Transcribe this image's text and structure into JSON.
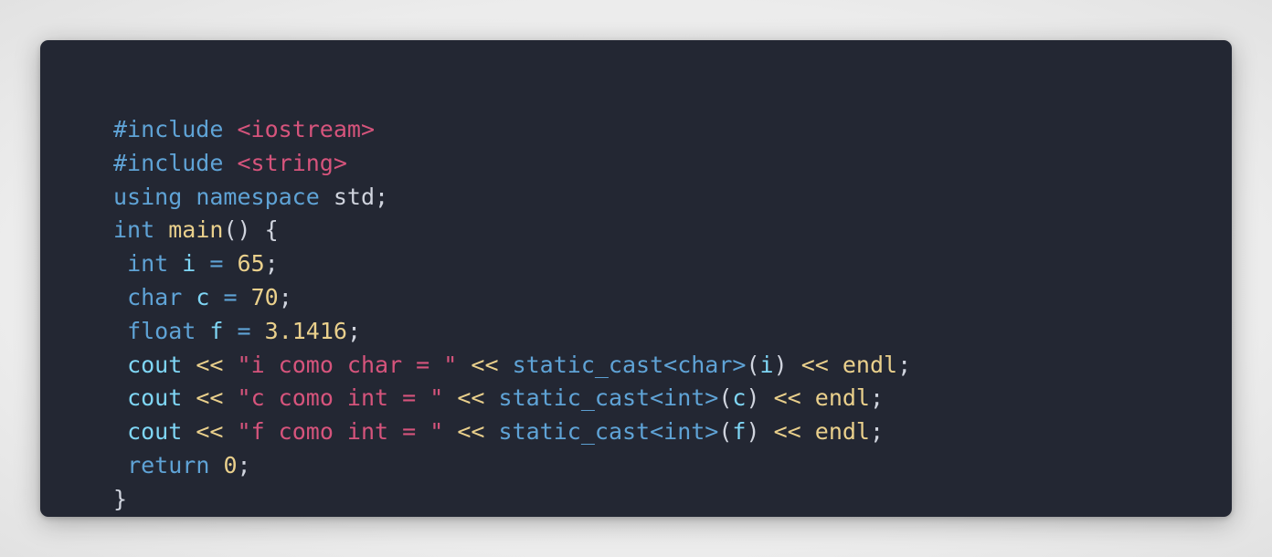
{
  "colors": {
    "background": "#ececec",
    "card": "#232733",
    "keyword": "#5fa3d6",
    "string": "#d6547c",
    "number": "#ead08c",
    "ident": "#7fd6f5",
    "function": "#ead08c",
    "plain": "#d0d4de"
  },
  "code": {
    "lines": [
      [
        {
          "t": "#include",
          "k": "keyword"
        },
        {
          "t": " ",
          "k": "plain"
        },
        {
          "t": "<iostream>",
          "k": "string"
        }
      ],
      [
        {
          "t": "#include",
          "k": "keyword"
        },
        {
          "t": " ",
          "k": "plain"
        },
        {
          "t": "<string>",
          "k": "string"
        }
      ],
      [
        {
          "t": "using",
          "k": "keyword"
        },
        {
          "t": " ",
          "k": "plain"
        },
        {
          "t": "namespace",
          "k": "keyword"
        },
        {
          "t": " std;",
          "k": "plain"
        }
      ],
      [
        {
          "t": "int",
          "k": "keyword"
        },
        {
          "t": " ",
          "k": "plain"
        },
        {
          "t": "main",
          "k": "function"
        },
        {
          "t": "() {",
          "k": "plain"
        }
      ],
      [
        {
          "t": " ",
          "k": "plain"
        },
        {
          "t": "int",
          "k": "keyword"
        },
        {
          "t": " ",
          "k": "plain"
        },
        {
          "t": "i",
          "k": "ident"
        },
        {
          "t": " ",
          "k": "plain"
        },
        {
          "t": "=",
          "k": "keyword"
        },
        {
          "t": " ",
          "k": "plain"
        },
        {
          "t": "65",
          "k": "number"
        },
        {
          "t": ";",
          "k": "plain"
        }
      ],
      [
        {
          "t": " ",
          "k": "plain"
        },
        {
          "t": "char",
          "k": "keyword"
        },
        {
          "t": " ",
          "k": "plain"
        },
        {
          "t": "c",
          "k": "ident"
        },
        {
          "t": " ",
          "k": "plain"
        },
        {
          "t": "=",
          "k": "keyword"
        },
        {
          "t": " ",
          "k": "plain"
        },
        {
          "t": "70",
          "k": "number"
        },
        {
          "t": ";",
          "k": "plain"
        }
      ],
      [
        {
          "t": " ",
          "k": "plain"
        },
        {
          "t": "float",
          "k": "keyword"
        },
        {
          "t": " ",
          "k": "plain"
        },
        {
          "t": "f",
          "k": "ident"
        },
        {
          "t": " ",
          "k": "plain"
        },
        {
          "t": "=",
          "k": "keyword"
        },
        {
          "t": " ",
          "k": "plain"
        },
        {
          "t": "3.1416",
          "k": "number"
        },
        {
          "t": ";",
          "k": "plain"
        }
      ],
      [
        {
          "t": " ",
          "k": "plain"
        },
        {
          "t": "cout",
          "k": "ident"
        },
        {
          "t": " ",
          "k": "plain"
        },
        {
          "t": "<<",
          "k": "number"
        },
        {
          "t": " ",
          "k": "plain"
        },
        {
          "t": "\"i como char = \"",
          "k": "string"
        },
        {
          "t": " ",
          "k": "plain"
        },
        {
          "t": "<<",
          "k": "number"
        },
        {
          "t": " ",
          "k": "plain"
        },
        {
          "t": "static_cast<char>",
          "k": "keyword"
        },
        {
          "t": "(",
          "k": "plain"
        },
        {
          "t": "i",
          "k": "ident"
        },
        {
          "t": ")",
          "k": "plain"
        },
        {
          "t": " ",
          "k": "plain"
        },
        {
          "t": "<<",
          "k": "number"
        },
        {
          "t": " ",
          "k": "plain"
        },
        {
          "t": "endl",
          "k": "number"
        },
        {
          "t": ";",
          "k": "plain"
        }
      ],
      [
        {
          "t": " ",
          "k": "plain"
        },
        {
          "t": "cout",
          "k": "ident"
        },
        {
          "t": " ",
          "k": "plain"
        },
        {
          "t": "<<",
          "k": "number"
        },
        {
          "t": " ",
          "k": "plain"
        },
        {
          "t": "\"c como int = \"",
          "k": "string"
        },
        {
          "t": " ",
          "k": "plain"
        },
        {
          "t": "<<",
          "k": "number"
        },
        {
          "t": " ",
          "k": "plain"
        },
        {
          "t": "static_cast<int>",
          "k": "keyword"
        },
        {
          "t": "(",
          "k": "plain"
        },
        {
          "t": "c",
          "k": "ident"
        },
        {
          "t": ")",
          "k": "plain"
        },
        {
          "t": " ",
          "k": "plain"
        },
        {
          "t": "<<",
          "k": "number"
        },
        {
          "t": " ",
          "k": "plain"
        },
        {
          "t": "endl",
          "k": "number"
        },
        {
          "t": ";",
          "k": "plain"
        }
      ],
      [
        {
          "t": " ",
          "k": "plain"
        },
        {
          "t": "cout",
          "k": "ident"
        },
        {
          "t": " ",
          "k": "plain"
        },
        {
          "t": "<<",
          "k": "number"
        },
        {
          "t": " ",
          "k": "plain"
        },
        {
          "t": "\"f como int = \"",
          "k": "string"
        },
        {
          "t": " ",
          "k": "plain"
        },
        {
          "t": "<<",
          "k": "number"
        },
        {
          "t": " ",
          "k": "plain"
        },
        {
          "t": "static_cast<int>",
          "k": "keyword"
        },
        {
          "t": "(",
          "k": "plain"
        },
        {
          "t": "f",
          "k": "ident"
        },
        {
          "t": ")",
          "k": "plain"
        },
        {
          "t": " ",
          "k": "plain"
        },
        {
          "t": "<<",
          "k": "number"
        },
        {
          "t": " ",
          "k": "plain"
        },
        {
          "t": "endl",
          "k": "number"
        },
        {
          "t": ";",
          "k": "plain"
        }
      ],
      [
        {
          "t": " ",
          "k": "plain"
        },
        {
          "t": "return",
          "k": "keyword"
        },
        {
          "t": " ",
          "k": "plain"
        },
        {
          "t": "0",
          "k": "number"
        },
        {
          "t": ";",
          "k": "plain"
        }
      ],
      [
        {
          "t": "}",
          "k": "plain"
        }
      ]
    ]
  }
}
